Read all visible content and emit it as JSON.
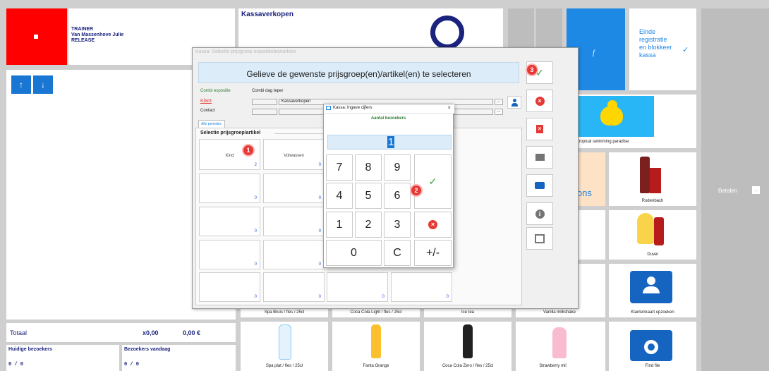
{
  "top": {
    "role": "TRAINER",
    "user": "Van Massenhove Julie",
    "mode": "RELEASE",
    "header_title": "Kassaverkopen",
    "f_label": "f",
    "einde_label": "Einde registratie en blokkeer kassa"
  },
  "totals": {
    "label": "Totaal",
    "qty": "x0,00",
    "amount": "0,00 €",
    "current_visitors_label": "Huidige bezoekers",
    "current_visitors_value": "0 / 0",
    "visitors_today_label": "Bezoekers vandaag",
    "visitors_today_value": "0 / 0"
  },
  "betalen_label": "Betalen",
  "partial_text": "ions",
  "tiles": {
    "swimming": "tropical swimming paradise",
    "rodenbach": "Rodenbach",
    "duvel": "Duvel",
    "klantenkaart": "Klantenkaart opzoeken",
    "spa": "Spa plat / fles / 25cl",
    "fanta": "Fanta Orange",
    "coca": "Coca Cola Zero / fles / 25cl",
    "milkshake": "Strawberry milkshake",
    "findfile": "Find file",
    "cut_spa": "Spa Bruis / fles / 25cl",
    "cut_coca": "Coca Cola Light / fles / 25cl",
    "cut_icetea": "Ice tea",
    "cut_vanilla": "Vanilla milkshake"
  },
  "dialog": {
    "title": "Kassa: Selectie prijsgroep expositiebezoekers",
    "banner": "Gelieve de gewenste prijsgroep(en)/artikel(en) te selecteren",
    "combi_label": "Combi expositie",
    "combi_value": "Combi dag Ieper",
    "klant_label": "Klant",
    "klant_value": "Kassaverkopen",
    "contact_label": "Contact",
    "tab": "Alle periodes",
    "group_title": "Selectie prijsgroep/artikel",
    "cells": [
      {
        "name": "Kind",
        "count": "2"
      },
      {
        "name": "Volwassen",
        "count": "0"
      },
      {
        "name": "",
        "count": "0"
      },
      {
        "name": "",
        "count": "0"
      },
      {
        "name": "",
        "count": "0"
      },
      {
        "name": "",
        "count": "0"
      },
      {
        "name": "",
        "count": "0"
      },
      {
        "name": "",
        "count": "0"
      },
      {
        "name": "",
        "count": "0"
      },
      {
        "name": "",
        "count": "0"
      },
      {
        "name": "",
        "count": "0"
      },
      {
        "name": "",
        "count": "0"
      }
    ],
    "ellipsis": "..."
  },
  "numpad": {
    "title": "Kassa: Ingave cijfers",
    "close": "×",
    "subtitle": "Aantal bezoekers",
    "value": "1",
    "keys": [
      "7",
      "8",
      "9",
      "4",
      "5",
      "6",
      "1",
      "2",
      "3",
      "0",
      "C",
      "+/-"
    ]
  },
  "badges": [
    "1",
    "2",
    "3"
  ],
  "colors": {
    "red_tile": "#ff0000",
    "accent_blue": "#1e88e5",
    "navy": "#1a237e",
    "confirm_green": "#43a047",
    "cancel_red": "#e53935"
  }
}
